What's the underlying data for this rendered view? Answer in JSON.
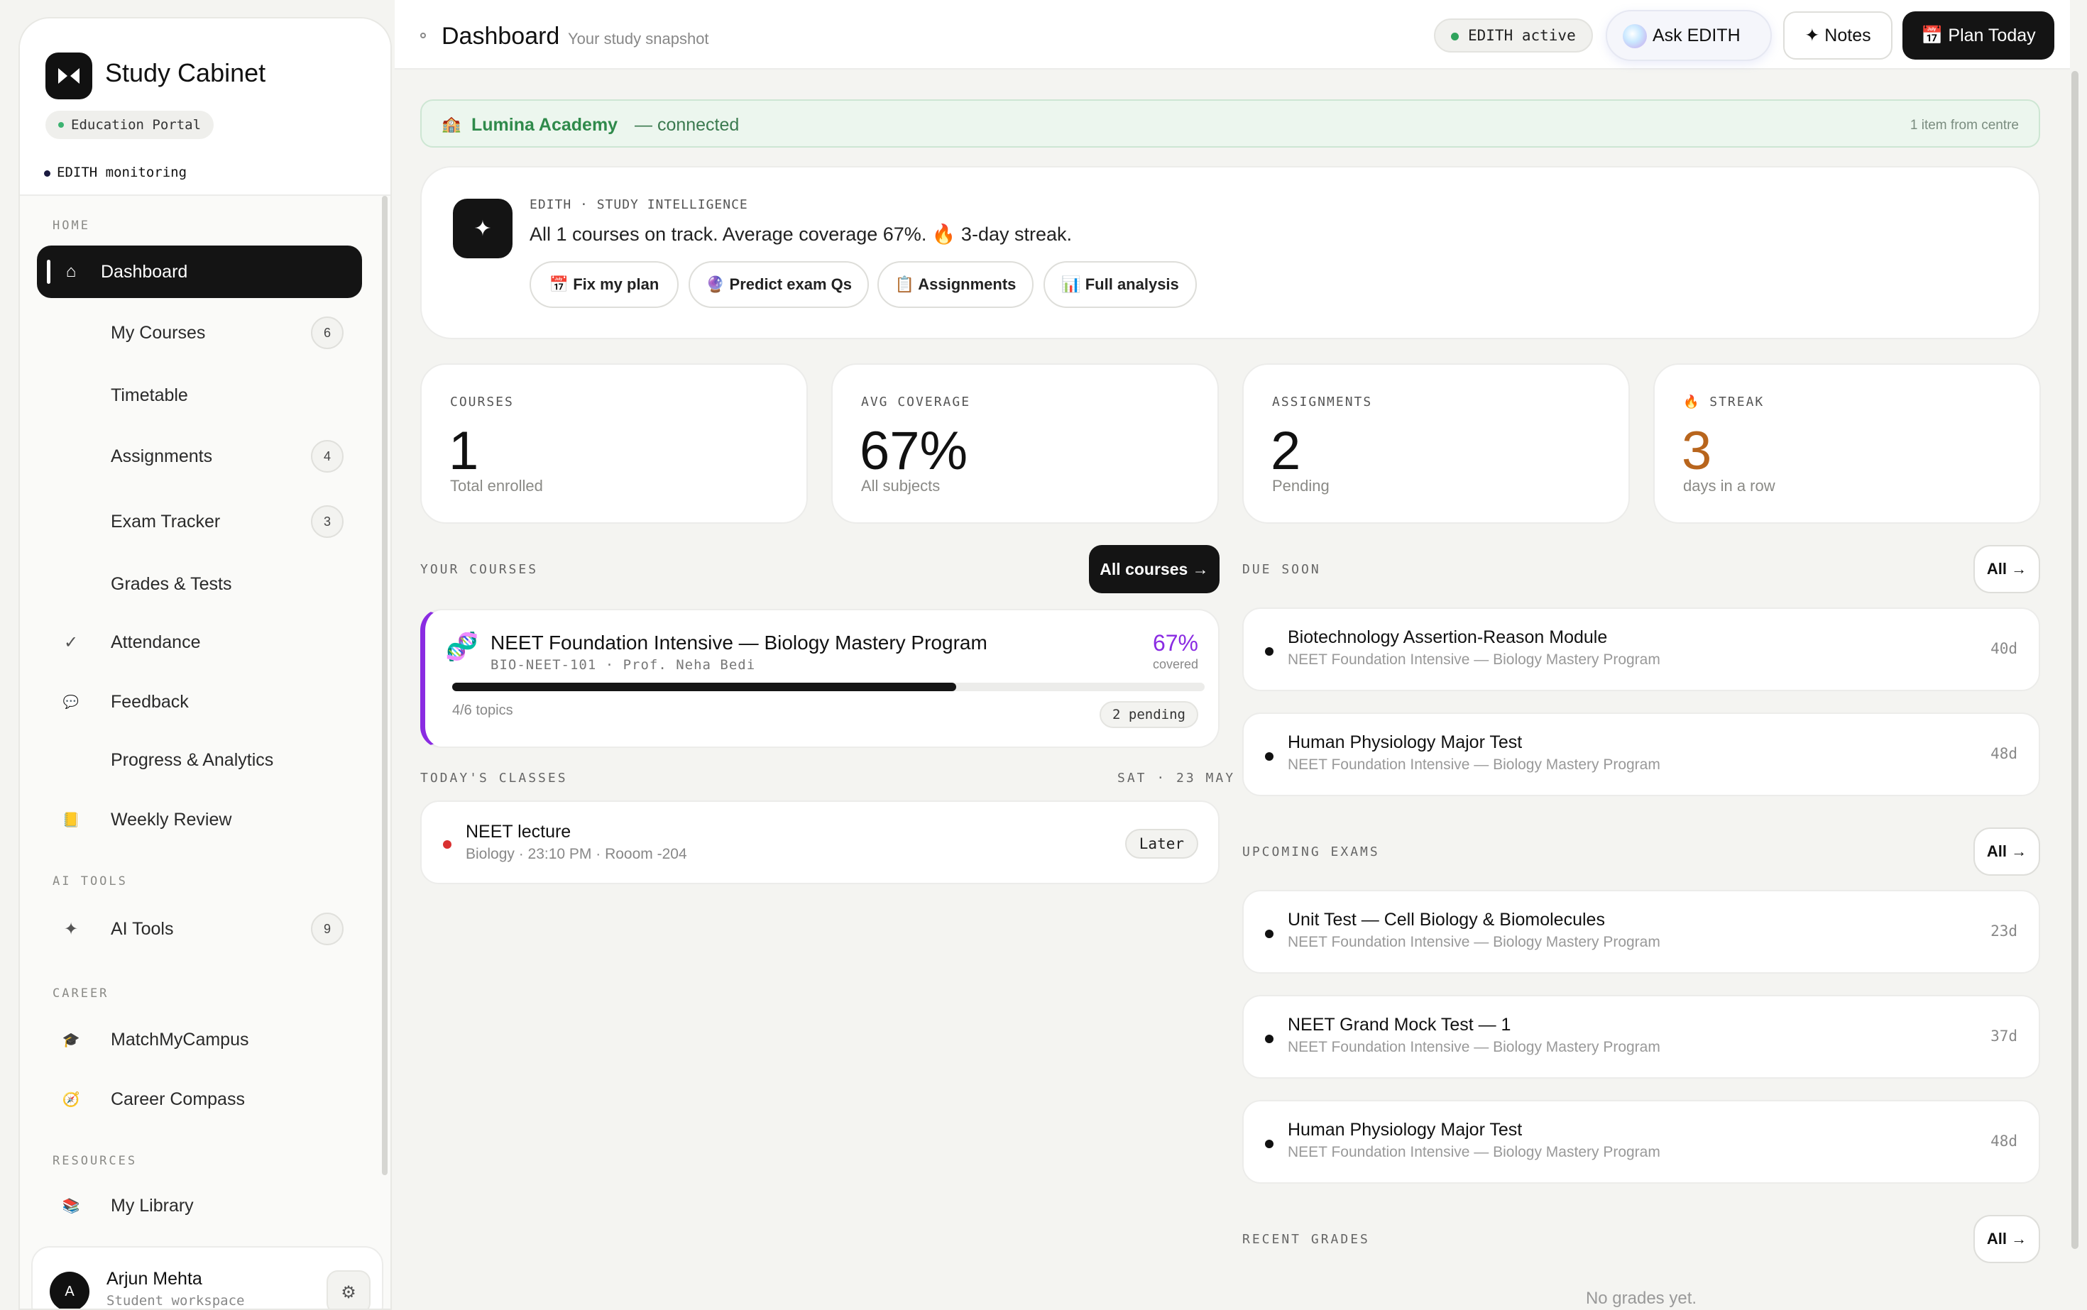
{
  "sidebar": {
    "brand": "Study Cabinet",
    "portal": "Education Portal",
    "monitoring": "EDITH monitoring",
    "sections": {
      "home": "HOME",
      "ai_tools": "AI TOOLS",
      "career": "CAREER",
      "resources": "RESOURCES"
    },
    "items": [
      {
        "label": "Dashboard",
        "icon": "home-icon",
        "glyph": "⌂",
        "active": true
      },
      {
        "label": "My Courses",
        "badge": "6"
      },
      {
        "label": "Timetable"
      },
      {
        "label": "Assignments",
        "badge": "4"
      },
      {
        "label": "Exam Tracker",
        "badge": "3"
      },
      {
        "label": "Grades & Tests"
      },
      {
        "label": "Attendance",
        "icon": "check-icon",
        "glyph": "✓"
      },
      {
        "label": "Feedback",
        "icon": "speech-bubble-icon",
        "glyph": "💬"
      },
      {
        "label": "Progress & Analytics"
      },
      {
        "label": "Weekly Review",
        "icon": "notebook-icon",
        "glyph": "📒"
      },
      {
        "label": "AI Tools",
        "icon": "sparkle-icon",
        "glyph": "✦",
        "badge": "9"
      },
      {
        "label": "MatchMyCampus",
        "icon": "graduation-cap-icon",
        "glyph": "🎓"
      },
      {
        "label": "Career Compass",
        "icon": "compass-icon",
        "glyph": "🧭"
      },
      {
        "label": "My Library",
        "icon": "books-icon",
        "glyph": "📚"
      }
    ],
    "user": {
      "initial": "A",
      "name": "Arjun Mehta",
      "role": "Student workspace"
    }
  },
  "header": {
    "title": "Dashboard",
    "subtitle": "Your study snapshot",
    "edith_status": "EDITH active",
    "ask_label": "Ask EDITH",
    "notes_label": "✦ Notes",
    "plan_label": "📅 Plan Today"
  },
  "banner": {
    "academy": "Lumina Academy",
    "status": "— connected",
    "right_text": "1 item from centre"
  },
  "intelligence": {
    "kicker": "EDITH · STUDY INTELLIGENCE",
    "message": "All 1 courses on track. Average coverage 67%. 🔥 3-day streak.",
    "chips": [
      "📅 Fix my plan",
      "🔮 Predict exam Qs",
      "📋 Assignments",
      "📊 Full analysis"
    ]
  },
  "stats": [
    {
      "key": "COURSES",
      "value": "1",
      "sub": "Total enrolled"
    },
    {
      "key": "AVG COVERAGE",
      "value": "67%",
      "sub": "All subjects"
    },
    {
      "key": "ASSIGNMENTS",
      "value": "2",
      "sub": "Pending"
    },
    {
      "key": "🔥 STREAK",
      "value": "3",
      "sub": "days in a row"
    }
  ],
  "courses": {
    "label": "YOUR COURSES",
    "all_label": "All courses →",
    "items": [
      {
        "name": "NEET Foundation Intensive — Biology Mastery Program",
        "code": "BIO-NEET-101 · Prof. Neha Bedi",
        "coverage_pct": "67%",
        "coverage_label": "covered",
        "progress": 0.67,
        "topics": "4/6 topics",
        "pending": "2 pending"
      }
    ]
  },
  "classes": {
    "label": "TODAY'S CLASSES",
    "date": "SAT · 23 MAY",
    "items": [
      {
        "title": "NEET lecture",
        "meta": "Biology · 23:10 PM · Rooom -204",
        "status": "Later"
      }
    ]
  },
  "due_soon": {
    "label": "DUE SOON",
    "all_label": "All →",
    "items": [
      {
        "title": "Biotechnology Assertion-Reason Module",
        "course": "NEET Foundation Intensive — Biology Mastery Program",
        "days": "40d"
      },
      {
        "title": "Human Physiology Major Test",
        "course": "NEET Foundation Intensive — Biology Mastery Program",
        "days": "48d"
      }
    ]
  },
  "exams": {
    "label": "UPCOMING EXAMS",
    "all_label": "All →",
    "items": [
      {
        "title": "Unit Test — Cell Biology & Biomolecules",
        "course": "NEET Foundation Intensive — Biology Mastery Program",
        "days": "23d"
      },
      {
        "title": "NEET Grand Mock Test — 1",
        "course": "NEET Foundation Intensive — Biology Mastery Program",
        "days": "37d"
      },
      {
        "title": "Human Physiology Major Test",
        "course": "NEET Foundation Intensive — Biology Mastery Program",
        "days": "48d"
      }
    ]
  },
  "grades": {
    "label": "RECENT GRADES",
    "all_label": "All →",
    "empty": "No grades yet."
  },
  "colors": {
    "accent_purple": "#8a2be2",
    "streak_orange": "#b8651d",
    "connected_green": "#2f8a4b"
  }
}
